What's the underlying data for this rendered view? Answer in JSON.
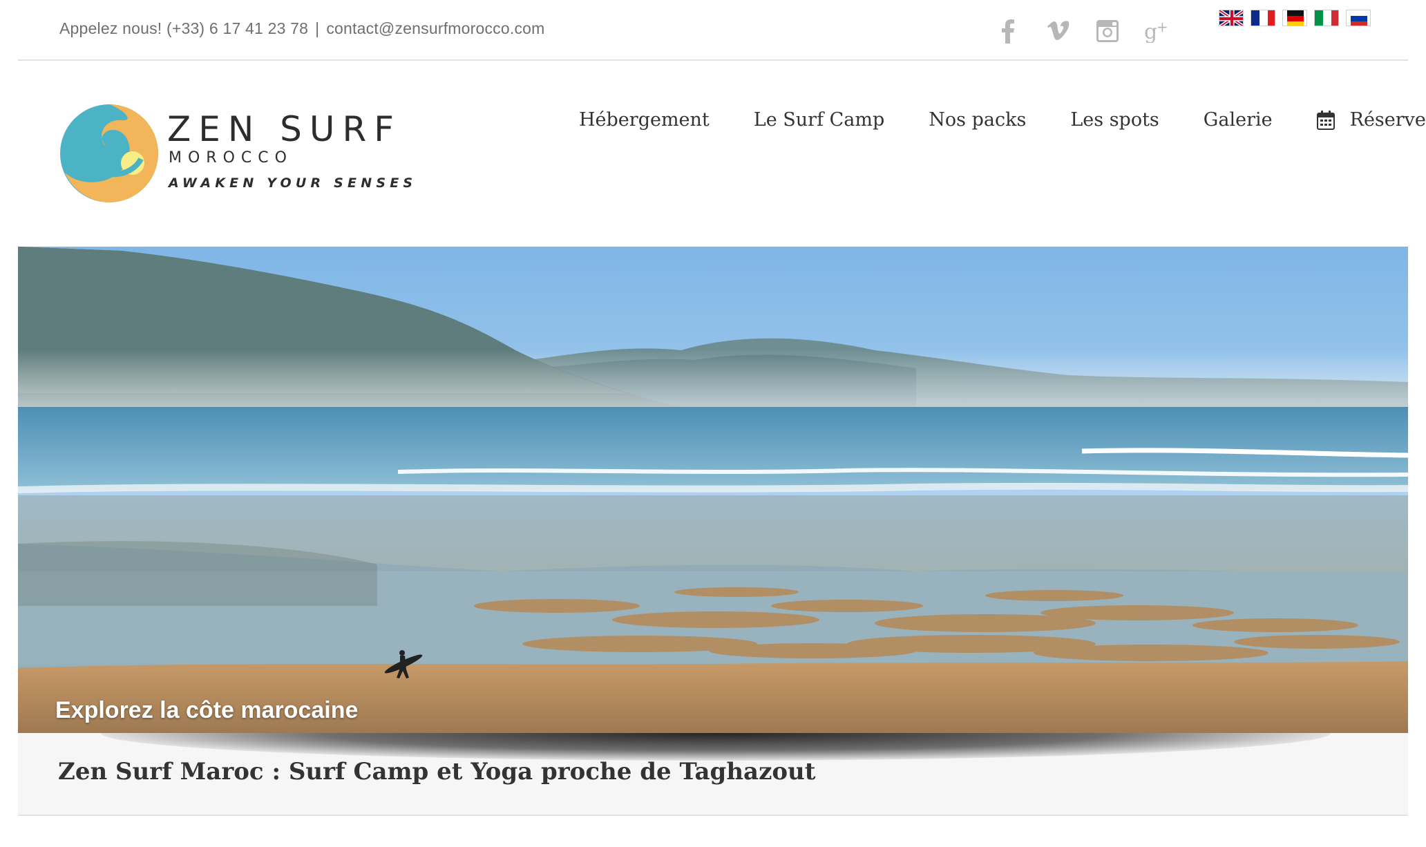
{
  "topbar": {
    "phone": "Appelez nous! (+33) 6 17 41 23 78",
    "separator": "|",
    "email": "contact@zensurfmorocco.com",
    "socials": [
      "facebook-icon",
      "vimeo-icon",
      "instagram-icon",
      "google-plus-icon"
    ],
    "languages": [
      "English",
      "Français",
      "Deutsch",
      "Italiano",
      "Русский"
    ]
  },
  "logo": {
    "title": "ZEN SURF",
    "subtitle": "MOROCCO",
    "tagline": "AWAKEN YOUR SENSES",
    "colors": {
      "teal": "#4bb3c4",
      "orange": "#f2b55a",
      "yellow": "#f7ef86"
    }
  },
  "nav": {
    "items": [
      {
        "label": "Hébergement"
      },
      {
        "label": "Le Surf Camp"
      },
      {
        "label": "Nos packs"
      },
      {
        "label": "Les spots"
      },
      {
        "label": "Galerie"
      },
      {
        "label": "Réserver",
        "icon": "calendar-icon"
      }
    ]
  },
  "hero": {
    "caption": "Explorez la côte marocaine"
  },
  "page": {
    "title": "Zen Surf Maroc : Surf Camp et Yoga proche de Taghazout"
  }
}
